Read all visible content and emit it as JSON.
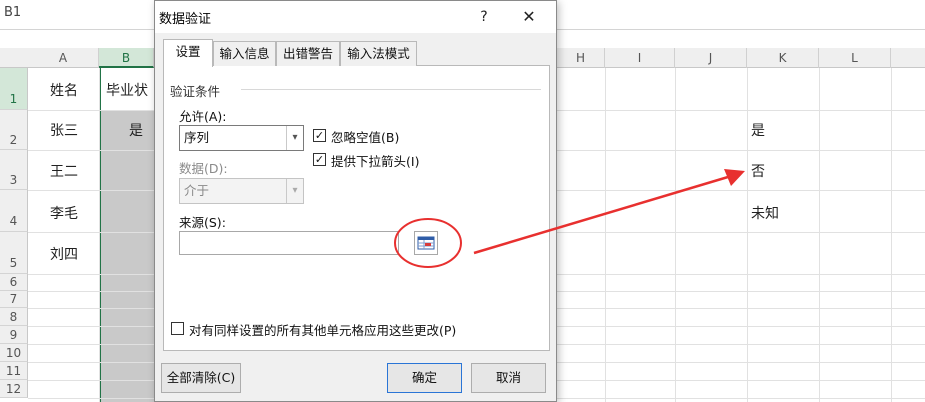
{
  "formula_bar": {
    "name_box": "B1"
  },
  "columns": [
    "A",
    "B",
    "H",
    "I",
    "J",
    "K",
    "L"
  ],
  "rows": [
    "1",
    "2",
    "3",
    "4",
    "5",
    "6",
    "7",
    "8",
    "9",
    "10",
    "11",
    "12"
  ],
  "cells": {
    "A1": "姓名",
    "A2": "张三",
    "A3": "王二",
    "A4": "李毛",
    "A5": "刘四",
    "B1": "毕业状",
    "B2": "是",
    "K2": "是",
    "K3": "否",
    "K4": "未知"
  },
  "dialog": {
    "title": "数据验证",
    "help": "?",
    "close": "✕",
    "tabs": [
      "设置",
      "输入信息",
      "出错警告",
      "输入法模式"
    ],
    "active_tab": "设置",
    "group_label": "验证条件",
    "allow_label": "允许(A):",
    "allow_value": "序列",
    "ignore_blank": "忽略空值(B)",
    "in_cell_dropdown": "提供下拉箭头(I)",
    "data_label": "数据(D):",
    "data_value": "介于",
    "source_label": "来源(S):",
    "source_value": "",
    "apply_all": "对有同样设置的所有其他单元格应用这些更改(P)",
    "clear_all": "全部清除(C)",
    "ok": "确定",
    "cancel": "取消"
  },
  "colors": {
    "accent": "#217346",
    "annotation": "#e8302f",
    "primary_border": "#2a75d6"
  }
}
